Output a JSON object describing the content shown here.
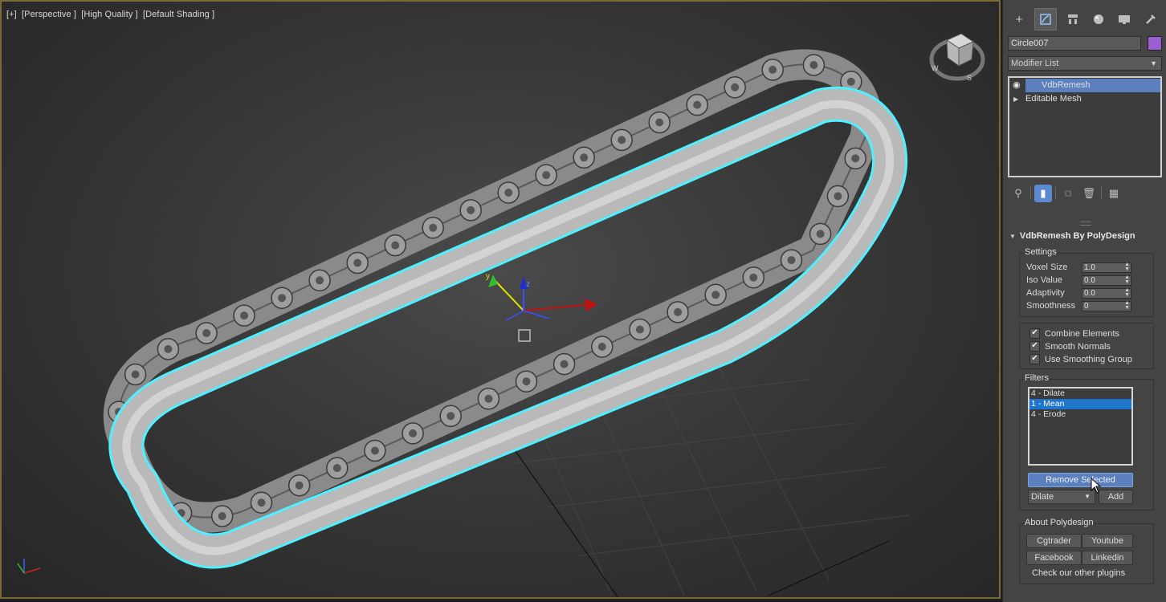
{
  "viewport": {
    "labels": [
      "[+]",
      "[Perspective ]",
      "[High Quality ]",
      "[Default Shading ]"
    ],
    "viewcube_labels": {
      "top": "TOP",
      "w": "W",
      "s": "S"
    },
    "gizmo_labels": {
      "x": "x",
      "y": "y",
      "z": "z"
    }
  },
  "command_panel": {
    "tabs": [
      "create-icon",
      "modify-icon",
      "hierarchy-icon",
      "motion-icon",
      "display-icon",
      "utilities-icon"
    ],
    "active_tab": 1,
    "object_name": "Circle007",
    "object_color": "#9a5fd0",
    "modifier_list_label": "Modifier List",
    "stack": [
      {
        "label": "VdbRemesh",
        "selected": true
      },
      {
        "label": "Editable Mesh",
        "selected": false
      }
    ]
  },
  "rollout": {
    "title": "VdbRemesh By PolyDesign",
    "settings_label": "Settings",
    "spinners": [
      {
        "label": "Voxel Size",
        "value": "1.0"
      },
      {
        "label": "Iso Value",
        "value": "0.0"
      },
      {
        "label": "Adaptivity",
        "value": "0.0"
      },
      {
        "label": "Smoothness",
        "value": "0"
      }
    ],
    "checkboxes": [
      {
        "label": "Combine Elements",
        "checked": true
      },
      {
        "label": "Smooth Normals",
        "checked": true
      },
      {
        "label": "Use Smoothing Group",
        "checked": true
      }
    ],
    "filters_label": "Filters",
    "filters": [
      "4 - Dilate",
      "1 - Mean",
      "4 - Erode"
    ],
    "selected_filter": 1,
    "remove_selected_label": "Remove Selected",
    "filter_type_value": "Dilate",
    "add_label": "Add",
    "about_label": "About Polydesign",
    "about_buttons": [
      "Cgtrader",
      "Youtube",
      "Facebook",
      "Linkedin"
    ],
    "check_other_label": "Check our other plugins"
  }
}
